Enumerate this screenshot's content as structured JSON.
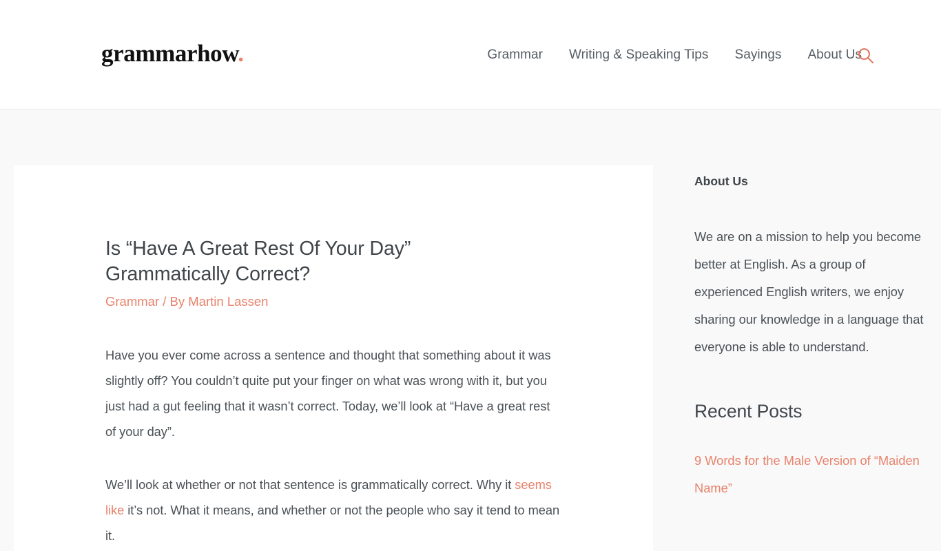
{
  "header": {
    "logo_text": "grammarhow",
    "logo_dot": ".",
    "nav": [
      {
        "label": "Grammar"
      },
      {
        "label": "Writing & Speaking Tips"
      },
      {
        "label": "Sayings"
      },
      {
        "label": "About Us"
      }
    ],
    "search_icon": "search-icon"
  },
  "article": {
    "title": "Is “Have A Great Rest Of Your Day” Grammatically Correct?",
    "category": "Grammar",
    "meta_separator": " / By ",
    "author": "Martin Lassen",
    "paragraph_1": "Have you ever come across a sentence and thought that something about it was slightly off? You couldn’t quite put your finger on what was wrong with it, but you just had a gut feeling that it wasn’t correct. Today, we’ll look at “Have a great rest of your day”.",
    "paragraph_2_part_1": "We’ll look at whether or not that sentence is grammatically correct. Why it ",
    "paragraph_2_link": "seems like",
    "paragraph_2_part_2": " it’s not. What it means, and whether or not the people who say it tend to mean it."
  },
  "sidebar": {
    "about_heading": "About Us",
    "about_text": "We are on a mission to help you become better at English. As a group of experienced English writers, we enjoy sharing our knowledge in a language that everyone is able to understand.",
    "recent_heading": "Recent Posts",
    "recent_posts": [
      {
        "title": "9 Words for the Male Version of “Maiden Name”"
      }
    ]
  },
  "colors": {
    "accent": "#e8826b",
    "body_text": "#4b5156",
    "nav_text": "#565c63",
    "page_background": "#f9f9f9",
    "card_background": "#ffffff"
  }
}
